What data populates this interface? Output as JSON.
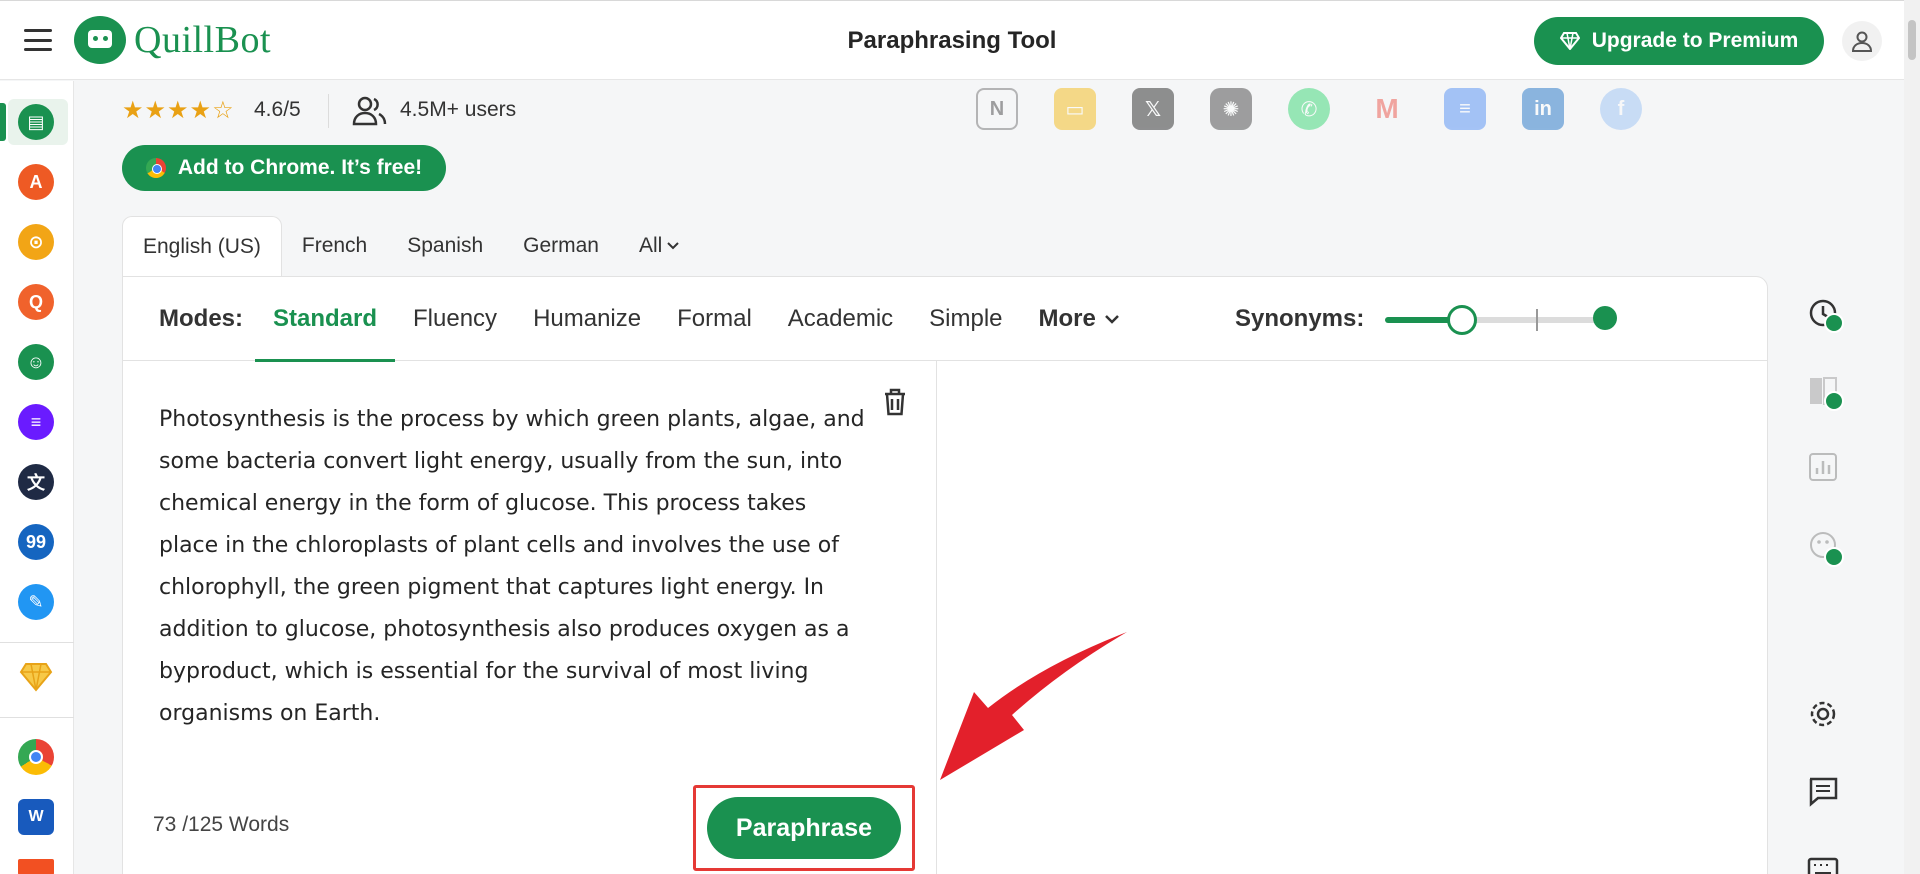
{
  "header": {
    "logo_text": "QuillBot",
    "title": "Paraphrasing Tool",
    "upgrade_label": "Upgrade to Premium"
  },
  "stats": {
    "stars": "★★★★☆",
    "rating": "4.6/5",
    "users": "4.5M+ users"
  },
  "integrations": [
    "notion-icon",
    "google-slides-icon",
    "x-icon",
    "chatgpt-icon",
    "whatsapp-icon",
    "gmail-icon",
    "google-docs-icon",
    "linkedin-icon",
    "facebook-icon"
  ],
  "chrome_cta": "Add to Chrome. It’s free!",
  "language_tabs": [
    "English (US)",
    "French",
    "Spanish",
    "German",
    "All"
  ],
  "modes_label": "Modes:",
  "modes": [
    "Standard",
    "Fluency",
    "Humanize",
    "Formal",
    "Academic",
    "Simple",
    "More"
  ],
  "active_mode": "Standard",
  "synonyms_label": "Synonyms:",
  "synonyms_level": 0.35,
  "input_text": "Photosynthesis is the process by which green plants, algae, and some bacteria convert light energy, usually from the sun, into chemical energy in the form of glucose. This process takes place in the chloroplasts of plant cells and involves the use of chlorophyll, the green pigment that captures light energy. In addition to glucose, photosynthesis also produces oxygen as a byproduct, which is essential for the survival of most living organisms on Earth.",
  "word_count": "73 /125 Words",
  "paraphrase_label": "Paraphrase",
  "colors": {
    "brand": "#1a9150",
    "highlight": "#e53935"
  }
}
